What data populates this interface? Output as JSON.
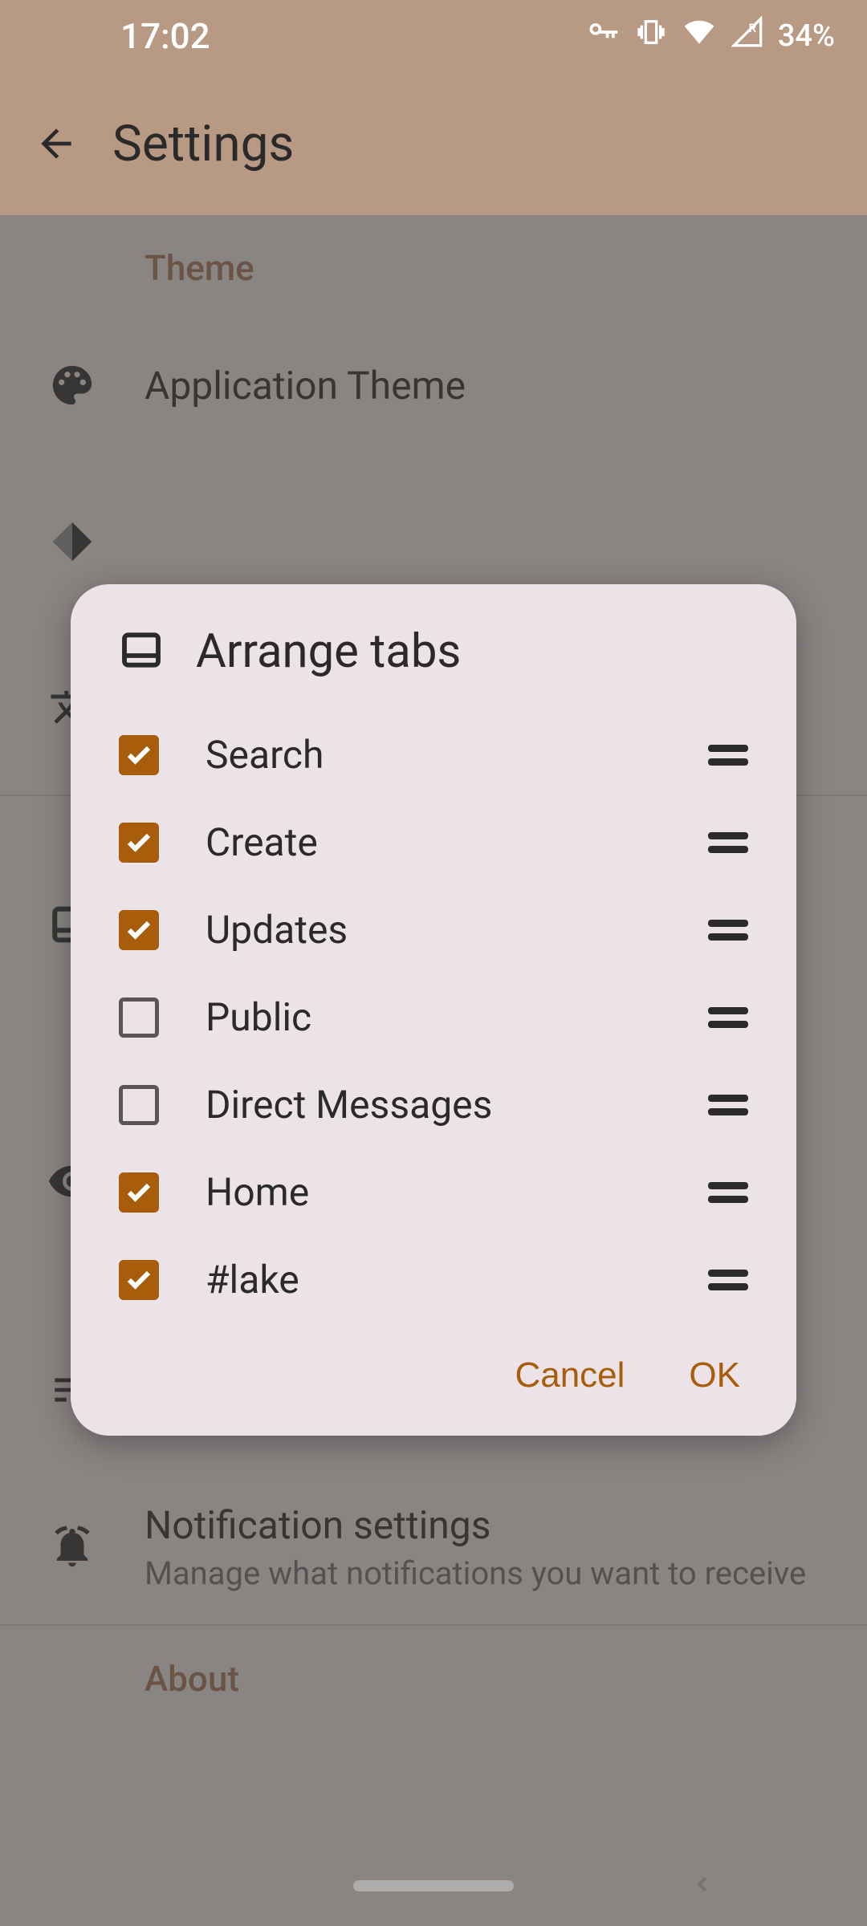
{
  "status": {
    "time": "17:02",
    "battery": "34%"
  },
  "appbar": {
    "title": "Settings"
  },
  "sections": {
    "theme_header": "Theme",
    "app_theme": "Application Theme",
    "notif_title": "Notification settings",
    "notif_sub": "Manage what notifications you want to receive",
    "about_header": "About"
  },
  "dialog": {
    "title": "Arrange tabs",
    "items": [
      {
        "label": "Search",
        "checked": true
      },
      {
        "label": "Create",
        "checked": true
      },
      {
        "label": "Updates",
        "checked": true
      },
      {
        "label": "Public",
        "checked": false
      },
      {
        "label": "Direct Messages",
        "checked": false
      },
      {
        "label": "Home",
        "checked": true
      },
      {
        "label": "#lake",
        "checked": true
      }
    ],
    "cancel": "Cancel",
    "ok": "OK"
  },
  "colors": {
    "accent": "#a85d0a",
    "appbar_bg": "#b89984"
  }
}
